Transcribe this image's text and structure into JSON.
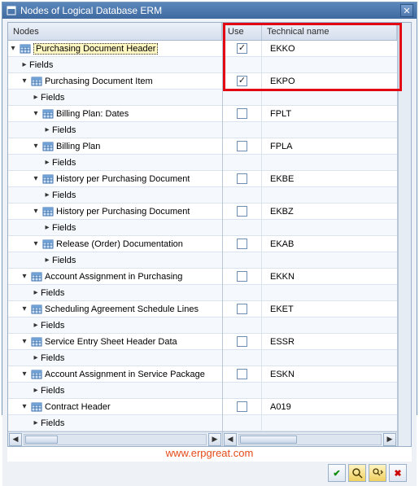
{
  "window": {
    "title": "Nodes of Logical Database ERM"
  },
  "columns": {
    "nodes": "Nodes",
    "use": "Use",
    "tech": "Technical name"
  },
  "rows": [
    {
      "level": 0,
      "expander": "down",
      "icon": "table",
      "label": "Purchasing Document Header",
      "selected": true,
      "use_checked": true,
      "tech": "EKKO"
    },
    {
      "level": 1,
      "expander": "right",
      "icon": "none",
      "label": "Fields",
      "use_checked": null,
      "tech": ""
    },
    {
      "level": 1,
      "expander": "down",
      "icon": "table",
      "label": "Purchasing Document Item",
      "use_checked": true,
      "tech": "EKPO"
    },
    {
      "level": 2,
      "expander": "right",
      "icon": "none",
      "label": "Fields",
      "use_checked": null,
      "tech": ""
    },
    {
      "level": 2,
      "expander": "down",
      "icon": "table",
      "label": "Billing Plan: Dates",
      "use_checked": false,
      "tech": "FPLT"
    },
    {
      "level": 3,
      "expander": "right",
      "icon": "none",
      "label": "Fields",
      "use_checked": null,
      "tech": ""
    },
    {
      "level": 2,
      "expander": "down",
      "icon": "table",
      "label": "Billing Plan",
      "use_checked": false,
      "tech": "FPLA"
    },
    {
      "level": 3,
      "expander": "right",
      "icon": "none",
      "label": "Fields",
      "use_checked": null,
      "tech": ""
    },
    {
      "level": 2,
      "expander": "down",
      "icon": "table",
      "label": "History per Purchasing Document",
      "use_checked": false,
      "tech": "EKBE"
    },
    {
      "level": 3,
      "expander": "right",
      "icon": "none",
      "label": "Fields",
      "use_checked": null,
      "tech": ""
    },
    {
      "level": 2,
      "expander": "down",
      "icon": "table",
      "label": "History per Purchasing Document",
      "use_checked": false,
      "tech": "EKBZ"
    },
    {
      "level": 3,
      "expander": "right",
      "icon": "none",
      "label": "Fields",
      "use_checked": null,
      "tech": ""
    },
    {
      "level": 2,
      "expander": "down",
      "icon": "table",
      "label": "Release (Order) Documentation",
      "use_checked": false,
      "tech": "EKAB"
    },
    {
      "level": 3,
      "expander": "right",
      "icon": "none",
      "label": "Fields",
      "use_checked": null,
      "tech": ""
    },
    {
      "level": 1,
      "expander": "down",
      "icon": "table",
      "label": "Account Assignment in Purchasing",
      "use_checked": false,
      "tech": "EKKN"
    },
    {
      "level": 2,
      "expander": "right",
      "icon": "none",
      "label": "Fields",
      "use_checked": null,
      "tech": ""
    },
    {
      "level": 1,
      "expander": "down",
      "icon": "table",
      "label": "Scheduling Agreement Schedule Lines",
      "use_checked": false,
      "tech": "EKET"
    },
    {
      "level": 2,
      "expander": "right",
      "icon": "none",
      "label": "Fields",
      "use_checked": null,
      "tech": ""
    },
    {
      "level": 1,
      "expander": "down",
      "icon": "table",
      "label": "Service Entry Sheet Header Data",
      "use_checked": false,
      "tech": "ESSR"
    },
    {
      "level": 2,
      "expander": "right",
      "icon": "none",
      "label": "Fields",
      "use_checked": null,
      "tech": ""
    },
    {
      "level": 1,
      "expander": "down",
      "icon": "table",
      "label": "Account Assignment in Service Package",
      "use_checked": false,
      "tech": "ESKN"
    },
    {
      "level": 2,
      "expander": "right",
      "icon": "none",
      "label": "Fields",
      "use_checked": null,
      "tech": ""
    },
    {
      "level": 1,
      "expander": "down",
      "icon": "table",
      "label": "Contract Header",
      "use_checked": false,
      "tech": "A019"
    },
    {
      "level": 2,
      "expander": "right",
      "icon": "none",
      "label": "Fields",
      "use_checked": null,
      "tech": ""
    }
  ],
  "watermark": "www.erpgreat.com",
  "icons": {
    "accept": "✔",
    "find": "🔍",
    "find_next": "🔎",
    "cancel": "✖"
  }
}
